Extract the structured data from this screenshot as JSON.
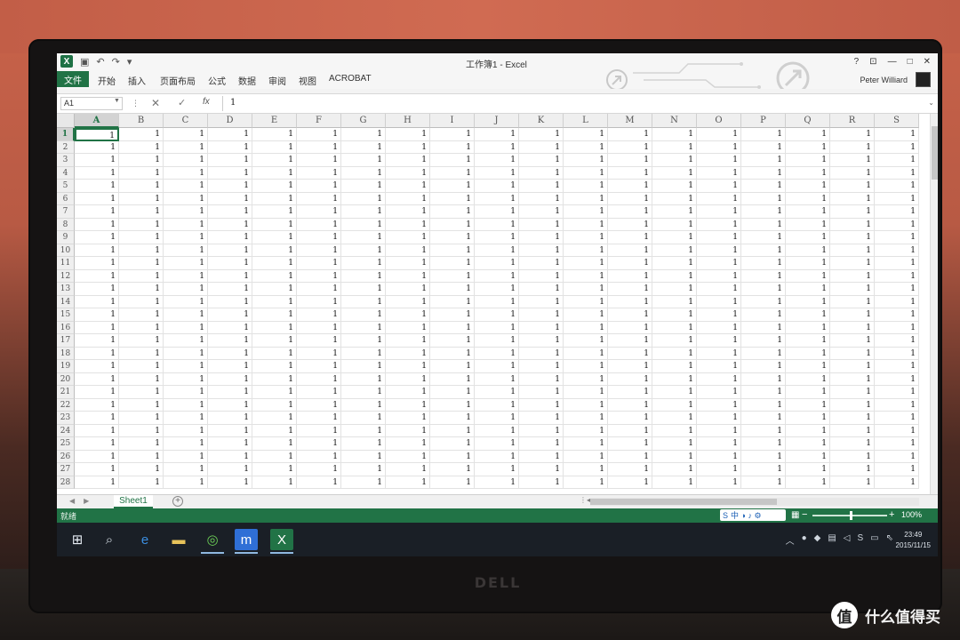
{
  "app": {
    "window_title": "工作簿1 - Excel",
    "user_name": "Peter Williard"
  },
  "quick_access": {
    "undo": "↶",
    "redo": "↷",
    "more": "▾"
  },
  "ribbon": {
    "file_tab": "文件",
    "tabs": [
      "开始",
      "插入",
      "页面布局",
      "公式",
      "数据",
      "审阅",
      "视图",
      "ACROBAT"
    ]
  },
  "window_controls": {
    "help": "?",
    "restore_ribbon": "⊡",
    "minimize": "—",
    "maximize": "□",
    "close": "✕"
  },
  "formula_bar": {
    "name_box": "A1",
    "fx_label": "fx",
    "value": "1"
  },
  "grid": {
    "columns": [
      "A",
      "B",
      "C",
      "D",
      "E",
      "F",
      "G",
      "H",
      "I",
      "J",
      "K",
      "L",
      "M",
      "N",
      "O",
      "P",
      "Q",
      "R",
      "S"
    ],
    "rows": [
      "1",
      "2",
      "3",
      "4",
      "5",
      "6",
      "7",
      "8",
      "9",
      "10",
      "11",
      "12",
      "13",
      "14",
      "15",
      "16",
      "17",
      "18",
      "19",
      "20",
      "21",
      "22",
      "23",
      "24",
      "25",
      "26",
      "27",
      "28"
    ],
    "cell_value": "1",
    "active_cell": "A1"
  },
  "sheets": {
    "tabs": [
      "Sheet1"
    ],
    "add_label": "+"
  },
  "status": {
    "ready": "就绪",
    "ime": "中 ◑ ♪ ⚙",
    "zoom_minus": "−",
    "zoom_plus": "+",
    "zoom": "100%",
    "zoom_fraction": 0.5
  },
  "taskbar": {
    "clock_time": "23:49",
    "clock_date": "2015/11/15"
  },
  "device_brand": "DELL",
  "watermark": {
    "logo": "值",
    "text": "什么值得买"
  },
  "colors": {
    "excel_green": "#217346",
    "taskbar": "#1a1f26"
  }
}
